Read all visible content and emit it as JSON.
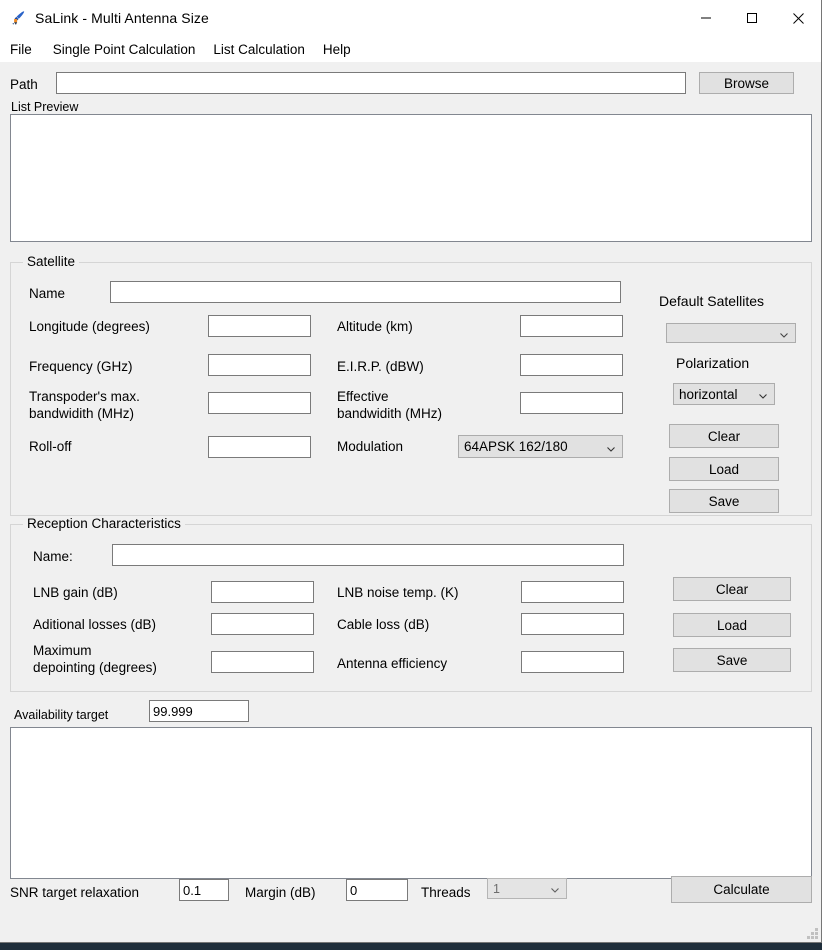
{
  "window": {
    "title": "SaLink - Multi Antenna Size",
    "icon": "rocket-icon",
    "controls": {
      "minimize": "minimize-icon",
      "maximize": "maximize-icon",
      "close": "close-icon"
    }
  },
  "menubar": {
    "items": [
      {
        "label": "File"
      },
      {
        "label": "Single Point Calculation"
      },
      {
        "label": "List Calculation"
      },
      {
        "label": "Help"
      }
    ]
  },
  "path_row": {
    "label": "Path",
    "value": "",
    "placeholder": "",
    "browse_label": "Browse"
  },
  "list_preview": {
    "label": "List Preview",
    "content": ""
  },
  "satellite": {
    "group_title": "Satellite",
    "name_label": "Name",
    "name_value": "",
    "fields": [
      {
        "label": "Longitude (degrees)",
        "value": ""
      },
      {
        "label": "Frequency (GHz)",
        "value": ""
      },
      {
        "label": "Transpoder's max.\nbandwidith (MHz)",
        "value": ""
      },
      {
        "label": "Roll-off",
        "value": ""
      }
    ],
    "fields_right": [
      {
        "label": "Altitude (km)",
        "value": ""
      },
      {
        "label": "E.I.R.P. (dBW)",
        "value": ""
      },
      {
        "label": "Effective\nbandwidith (MHz)",
        "value": ""
      }
    ],
    "modulation_label": "Modulation",
    "modulation_value": "64APSK 162/180",
    "default_satellites_label": "Default Satellites",
    "default_satellites_value": "",
    "polarization_label": "Polarization",
    "polarization_value": "horizontal",
    "buttons": [
      {
        "label": "Clear"
      },
      {
        "label": "Load"
      },
      {
        "label": "Save"
      }
    ]
  },
  "reception": {
    "group_title": "Reception Characteristics",
    "name_label": "Name:",
    "name_value": "",
    "fields": [
      {
        "label": "LNB gain (dB)",
        "value": ""
      },
      {
        "label": "Aditional losses (dB)",
        "value": ""
      },
      {
        "label": "Maximum\ndepointing (degrees)",
        "value": ""
      }
    ],
    "fields_right": [
      {
        "label": "LNB noise temp. (K)",
        "value": ""
      },
      {
        "label": "Cable loss (dB)",
        "value": ""
      },
      {
        "label": "Antenna efficiency",
        "value": ""
      }
    ],
    "buttons": [
      {
        "label": "Clear"
      },
      {
        "label": "Load"
      },
      {
        "label": "Save"
      }
    ]
  },
  "availability": {
    "label": "Availability target",
    "value": "99.999"
  },
  "output": {
    "content": ""
  },
  "bottom_bar": {
    "snr_label": "SNR target relaxation",
    "snr_value": "0.1",
    "margin_label": "Margin (dB)",
    "margin_value": "0",
    "threads_label": "Threads",
    "threads_value": "1",
    "threads_enabled": false,
    "calculate_label": "Calculate"
  },
  "colors": {
    "window_bg": "#f0f0f0",
    "button_face": "#e1e1e1",
    "field_bg": "#ffffff",
    "border": "#7a7a7a",
    "group_border": "#d5d5d5",
    "taskbar": "#1f2e3b"
  }
}
